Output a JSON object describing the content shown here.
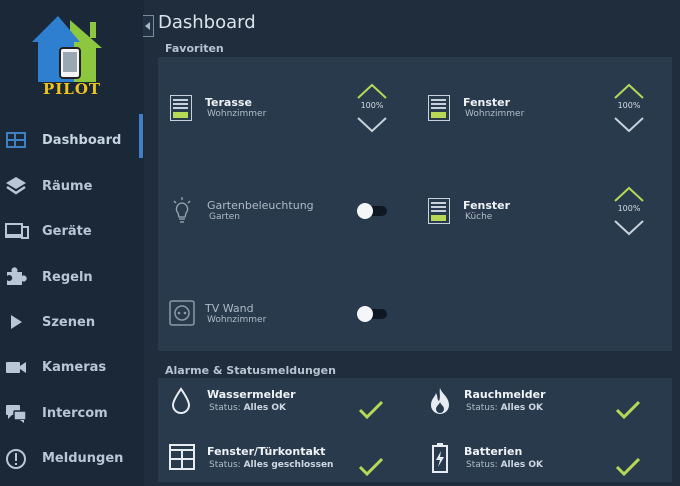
{
  "app": {
    "logo_text": "PILOT"
  },
  "sidebar": {
    "items": [
      {
        "label": "Dashboard",
        "icon": "dashboard-icon",
        "active": true
      },
      {
        "label": "Räume",
        "icon": "layers-icon",
        "active": false
      },
      {
        "label": "Geräte",
        "icon": "devices-icon",
        "active": false
      },
      {
        "label": "Regeln",
        "icon": "puzzle-icon",
        "active": false
      },
      {
        "label": "Szenen",
        "icon": "play-icon",
        "active": false
      },
      {
        "label": "Kameras",
        "icon": "camera-icon",
        "active": false
      },
      {
        "label": "Intercom",
        "icon": "chat-icon",
        "active": false
      },
      {
        "label": "Meldungen",
        "icon": "alert-icon",
        "active": false
      }
    ]
  },
  "main": {
    "title": "Dashboard"
  },
  "favorites": {
    "label": "Favoriten",
    "tiles": [
      {
        "title": "Terasse",
        "room": "Wohnzimmer",
        "type": "shutter",
        "percent": "100%"
      },
      {
        "title": "Fenster",
        "room": "Wohnzimmer",
        "type": "shutter",
        "percent": "100%"
      },
      {
        "title": "Gartenbeleuchtung",
        "room": "Garten",
        "type": "light",
        "state": "off"
      },
      {
        "title": "Fenster",
        "room": "Küche",
        "type": "shutter",
        "percent": "100%"
      },
      {
        "title": "TV Wand",
        "room": "Wohnzimmer",
        "type": "socket",
        "state": "off"
      }
    ]
  },
  "alarms": {
    "label": "Alarme & Statusmeldungen",
    "status_prefix": "Status:",
    "tiles": [
      {
        "title": "Wassermelder",
        "status": "Alles OK",
        "icon": "water-drop-icon"
      },
      {
        "title": "Rauchmelder",
        "status": "Alles OK",
        "icon": "flame-icon"
      },
      {
        "title": "Fenster/Türkontakt",
        "status": "Alles geschlossen",
        "icon": "window-icon"
      },
      {
        "title": "Batterien",
        "status": "Alles OK",
        "icon": "battery-icon"
      }
    ]
  },
  "colors": {
    "accent_green": "#b7d857",
    "accent_blue": "#3f7fc4",
    "sidebar_bg": "#1a2838",
    "panel_bg": "#2a3a4d"
  }
}
